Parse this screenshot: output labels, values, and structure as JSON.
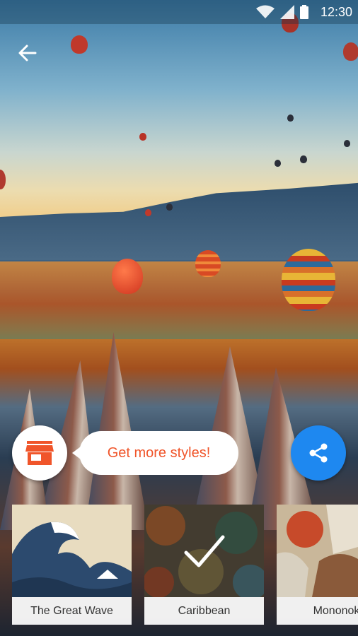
{
  "status_bar": {
    "time": "12:30"
  },
  "promo": {
    "label": "Get more styles!"
  },
  "styles": [
    {
      "label": "The Great Wave",
      "selected": false
    },
    {
      "label": "Caribbean",
      "selected": true
    },
    {
      "label": "Mononok",
      "selected": false
    }
  ],
  "colors": {
    "accent_orange": "#f0552a",
    "share_blue": "#1e88f0"
  },
  "icons": {
    "back": "arrow-left-icon",
    "store": "store-icon",
    "share": "share-icon",
    "selected": "checkmark-icon"
  }
}
